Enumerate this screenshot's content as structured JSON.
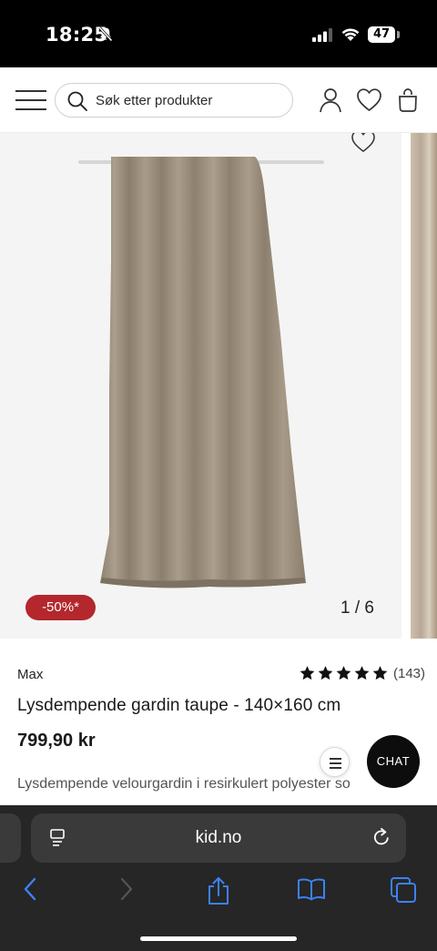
{
  "status_bar": {
    "time": "18:25",
    "battery": "47",
    "icons": [
      "bell-off-icon",
      "signal-icon",
      "wifi-icon",
      "battery-icon"
    ]
  },
  "header": {
    "search_placeholder": "Søk etter produkter",
    "icons": [
      "menu-icon",
      "search-icon",
      "account-icon",
      "wishlist-icon",
      "cart-icon"
    ]
  },
  "gallery": {
    "discount_badge": "-50%*",
    "counter": "1 / 6",
    "current_image": 1,
    "total_images": 6
  },
  "product": {
    "brand": "Max",
    "rating_stars": 5,
    "rating_count": "(143)",
    "title": "Lysdempende gardin taupe - 140×160 cm",
    "price": "799,90 kr",
    "description": "Lysdempende velourgardin i resirkulert polyester so"
  },
  "widgets": {
    "chat_label": "CHAT"
  },
  "browser": {
    "url": "kid.no",
    "icons": [
      "back-icon",
      "forward-icon",
      "share-icon",
      "bookmarks-icon",
      "tabs-icon",
      "reader-icon",
      "reload-icon"
    ]
  },
  "colors": {
    "badge": "#b3272d",
    "chat": "#0d0d0d",
    "browser_accent": "#3b82f6",
    "curtain": "#9c8f7e"
  }
}
